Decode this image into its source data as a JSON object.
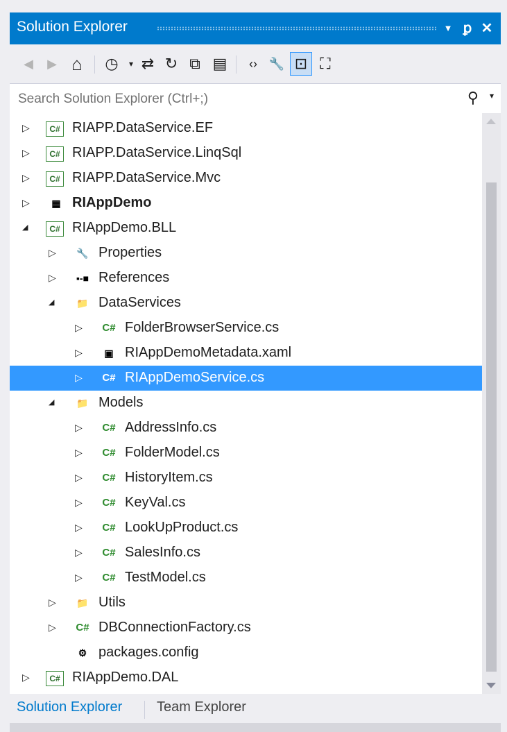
{
  "window": {
    "title": "Solution Explorer",
    "dropdown_icon": "▼",
    "pin_icon": "ꝑ",
    "close_icon": "✕"
  },
  "toolbar": {
    "back_icon": "◀",
    "forward_icon": "▶",
    "home_icon": "⌂",
    "pending_changes_icon": "◷",
    "sync_icon": "⇄",
    "refresh_icon": "↻",
    "collapse_all_icon": "⧉",
    "show_all_files_icon": "▤",
    "view_code_icon": "‹›",
    "properties_icon": "🔧",
    "preview_selected_icon": "⊡",
    "class_view_icon": "⛶"
  },
  "search": {
    "placeholder": "Search Solution Explorer (Ctrl+;)",
    "icon": "⚲",
    "dropdown": "▾"
  },
  "tree": [
    {
      "label": "RIAPP.DataService.EF",
      "arrow": "▷",
      "icon": "C#",
      "icon_type": "csproj"
    },
    {
      "label": "RIAPP.DataService.LinqSql",
      "arrow": "▷",
      "icon": "C#",
      "icon_type": "csproj"
    },
    {
      "label": "RIAPP.DataService.Mvc",
      "arrow": "▷",
      "icon": "C#",
      "icon_type": "csproj"
    },
    {
      "label": "RIAppDemo",
      "arrow": "▷",
      "icon": "▦",
      "icon_type": "webproj",
      "bold": true
    },
    {
      "label": "RIAppDemo.BLL",
      "arrow": "◢",
      "icon": "C#",
      "icon_type": "csproj"
    },
    {
      "label": "Properties",
      "arrow": "▷",
      "icon": "🔧",
      "icon_type": "properties"
    },
    {
      "label": "References",
      "arrow": "▷",
      "icon": "▪‑■",
      "icon_type": "references"
    },
    {
      "label": "DataServices",
      "arrow": "◢",
      "icon": "📁",
      "icon_type": "folder"
    },
    {
      "label": "FolderBrowserService.cs",
      "arrow": "▷",
      "icon": "C#",
      "icon_type": "csfile"
    },
    {
      "label": "RIAppDemoMetadata.xaml",
      "arrow": "▷",
      "icon": "▣",
      "icon_type": "xaml"
    },
    {
      "label": "RIAppDemoService.cs",
      "arrow": "▷",
      "icon": "C#",
      "icon_type": "csfile",
      "selected": true
    },
    {
      "label": "Models",
      "arrow": "◢",
      "icon": "📁",
      "icon_type": "folder"
    },
    {
      "label": "AddressInfo.cs",
      "arrow": "▷",
      "icon": "C#",
      "icon_type": "csfile"
    },
    {
      "label": "FolderModel.cs",
      "arrow": "▷",
      "icon": "C#",
      "icon_type": "csfile"
    },
    {
      "label": "HistoryItem.cs",
      "arrow": "▷",
      "icon": "C#",
      "icon_type": "csfile"
    },
    {
      "label": "KeyVal.cs",
      "arrow": "▷",
      "icon": "C#",
      "icon_type": "csfile"
    },
    {
      "label": "LookUpProduct.cs",
      "arrow": "▷",
      "icon": "C#",
      "icon_type": "csfile"
    },
    {
      "label": "SalesInfo.cs",
      "arrow": "▷",
      "icon": "C#",
      "icon_type": "csfile"
    },
    {
      "label": "TestModel.cs",
      "arrow": "▷",
      "icon": "C#",
      "icon_type": "csfile"
    },
    {
      "label": "Utils",
      "arrow": "▷",
      "icon": "📁",
      "icon_type": "folder"
    },
    {
      "label": "DBConnectionFactory.cs",
      "arrow": "▷",
      "icon": "C#",
      "icon_type": "csfile"
    },
    {
      "label": "packages.config",
      "arrow": "",
      "icon": "⚙",
      "icon_type": "config"
    },
    {
      "label": "RIAppDemo.DAL",
      "arrow": "▷",
      "icon": "C#",
      "icon_type": "csproj"
    }
  ],
  "tabs": [
    {
      "label": "Solution Explorer",
      "active": true
    },
    {
      "label": "Team Explorer",
      "active": false
    }
  ],
  "colors": {
    "accent": "#007acc",
    "selection": "#3399ff",
    "csharp_green": "#2e8b2e"
  }
}
